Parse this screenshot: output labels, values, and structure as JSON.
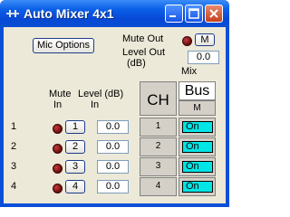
{
  "window": {
    "title": "Auto Mixer 4x1"
  },
  "titlebar_icons": [
    "app-icon",
    "minimize-icon",
    "maximize-icon",
    "close-icon"
  ],
  "top": {
    "mic_options_label": "Mic Options",
    "mute_out_label": "Mute Out",
    "mute_out_button": "M",
    "level_out_label_line1": "Level Out",
    "level_out_label_line2": "(dB)",
    "level_out_value": "0.0",
    "mix_label": "Mix"
  },
  "inputs": {
    "mute_in_header_line1": "Mute",
    "mute_in_header_line2": "In",
    "level_header_line1": "Level (dB)",
    "level_header_line2": "In",
    "rows": [
      {
        "label": "1",
        "button": "1",
        "level": "0.0"
      },
      {
        "label": "2",
        "button": "2",
        "level": "0.0"
      },
      {
        "label": "3",
        "button": "3",
        "level": "0.0"
      },
      {
        "label": "4",
        "button": "4",
        "level": "0.0"
      }
    ]
  },
  "matrix": {
    "ch_header": "CH",
    "bus_header": "Bus",
    "bus_sub": "M",
    "rows": [
      {
        "ch": "1",
        "state": "On"
      },
      {
        "ch": "2",
        "state": "On"
      },
      {
        "ch": "3",
        "state": "On"
      },
      {
        "ch": "4",
        "state": "On"
      }
    ]
  },
  "colors": {
    "led": "#8b1010",
    "on_cell": "#00e5e5",
    "titlebar": "#0b5fe8",
    "close": "#c7401d"
  }
}
